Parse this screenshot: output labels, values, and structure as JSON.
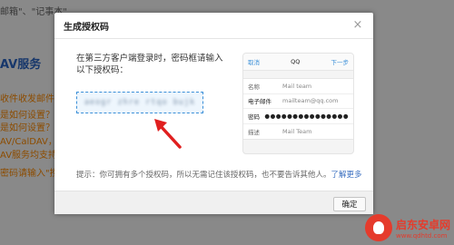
{
  "background": {
    "quote_line": "邮箱\"、\"记事本\"",
    "section_title": "AV服务",
    "lines": [
      "收件收发邮件？",
      "是如何设置？",
      "是如何设置？)",
      "AV/CalDAV，它",
      "AV服务均支持SSL",
      "密码请输入\"授权"
    ]
  },
  "dialog": {
    "title": "生成授权码",
    "close_symbol": "×",
    "instruction": "在第三方客户端登录时，密码框请输入以下授权码：",
    "auth_code": "aeogr zhre rtqo bujk",
    "phone": {
      "cancel": "取消",
      "title": "QQ",
      "next": "下一步",
      "rows": [
        {
          "label": "名称",
          "value": "Mail team"
        },
        {
          "label": "电子邮件",
          "value": "mailteam@qq.com"
        },
        {
          "label": "密码",
          "value": "●●●●●●●●●●●●●●●"
        },
        {
          "label": "描述",
          "value": "Mail Team"
        }
      ]
    },
    "tip_text": "提示：你可拥有多个授权码，所以无需记住该授权码，也不要告诉其他人。",
    "tip_link": "了解更多",
    "confirm_label": "确定"
  },
  "watermark": {
    "name": "启东安卓网",
    "url": "www.qdhtd.com"
  },
  "colors": {
    "accent": "#3a8fd8",
    "arrow": "#e01f1f",
    "brand": "#e53b2c"
  }
}
